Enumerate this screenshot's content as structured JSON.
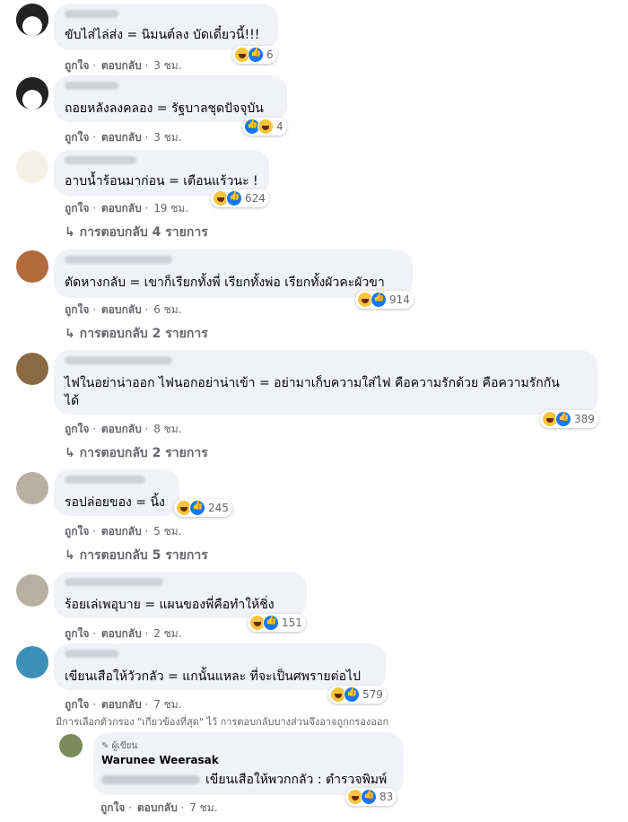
{
  "comments": [
    {
      "text": "ขับไส่ไล่ส่ง = นิมนต์ลง บัดเดี๋ยวนี้!!!",
      "time": "3 ชม.",
      "count": "6",
      "order": "haha-like"
    },
    {
      "text": "ถอยหลังลงคลอง = รัฐบาลชุดปัจจุบัน",
      "time": "3 ชม.",
      "count": "4",
      "order": "like-haha"
    },
    {
      "text": "อาบน้ำร้อนมาก่อน = เตือนแร้วนะ !",
      "time": "19 ชม.",
      "count": "624",
      "replies": "การตอบกลับ 4 รายการ",
      "order": "haha-like"
    },
    {
      "text": "ตัดหางกลับ = เขาก็เรียกทั้งพี่ เรียกทั้งพ่อ เรียกทั้งผัวคะผัวขา",
      "time": "6 ชม.",
      "count": "914",
      "replies": "การตอบกลับ 2 รายการ",
      "order": "haha-like"
    },
    {
      "text": "ไฟในอย่าน่าออก ไฟนอกอย่าน่าเข้า = อย่ามาเก็บความใส่ไฟ คือความรักด้วย คือความรักกัน",
      "text2": "ได้",
      "time": "8 ชม.",
      "count": "389",
      "replies": "การตอบกลับ 2 รายการ",
      "order": "haha-like"
    },
    {
      "text": "รอปล่อยของ = นิ้ง",
      "time": "5 ชม.",
      "count": "245",
      "replies": "การตอบกลับ 5 รายการ",
      "order": "haha-like"
    },
    {
      "text": "ร้อยเล่เพอุบาย = แผนของพี่คือทำให้ชิ่ง",
      "time": "2 ชม.",
      "count": "151",
      "order": "haha-like"
    },
    {
      "text": "เขียนเสือให้วัวกลัว = แกนั้นแหละ ที่จะเป็นศพรายต่อไป",
      "time": "7 ชม.",
      "count": "579",
      "order": "haha-like"
    }
  ],
  "actions": {
    "like": "ถูกใจ",
    "sep": " · ",
    "reply": "ตอบกลับ",
    "dot": " · "
  },
  "filter_note": "มีการเลือกตัวกรอง \"เกี่ยวข้องที่สุด\" ไว้ การตอบกลับบางส่วนจึงอาจถูกกรองออก",
  "reply": {
    "author_tag": "✎ ผู้เขียน",
    "author": "Warunee Weerasak",
    "text": "เขียนเสือให้พวกกลัว : ตำรวจพิมพ์",
    "time": "7 ชม.",
    "count": "83"
  },
  "colors": {
    "bubble": "#f0f2f5",
    "meta": "#65676b",
    "like": "#1877f2",
    "haha": "#f7c53d"
  }
}
